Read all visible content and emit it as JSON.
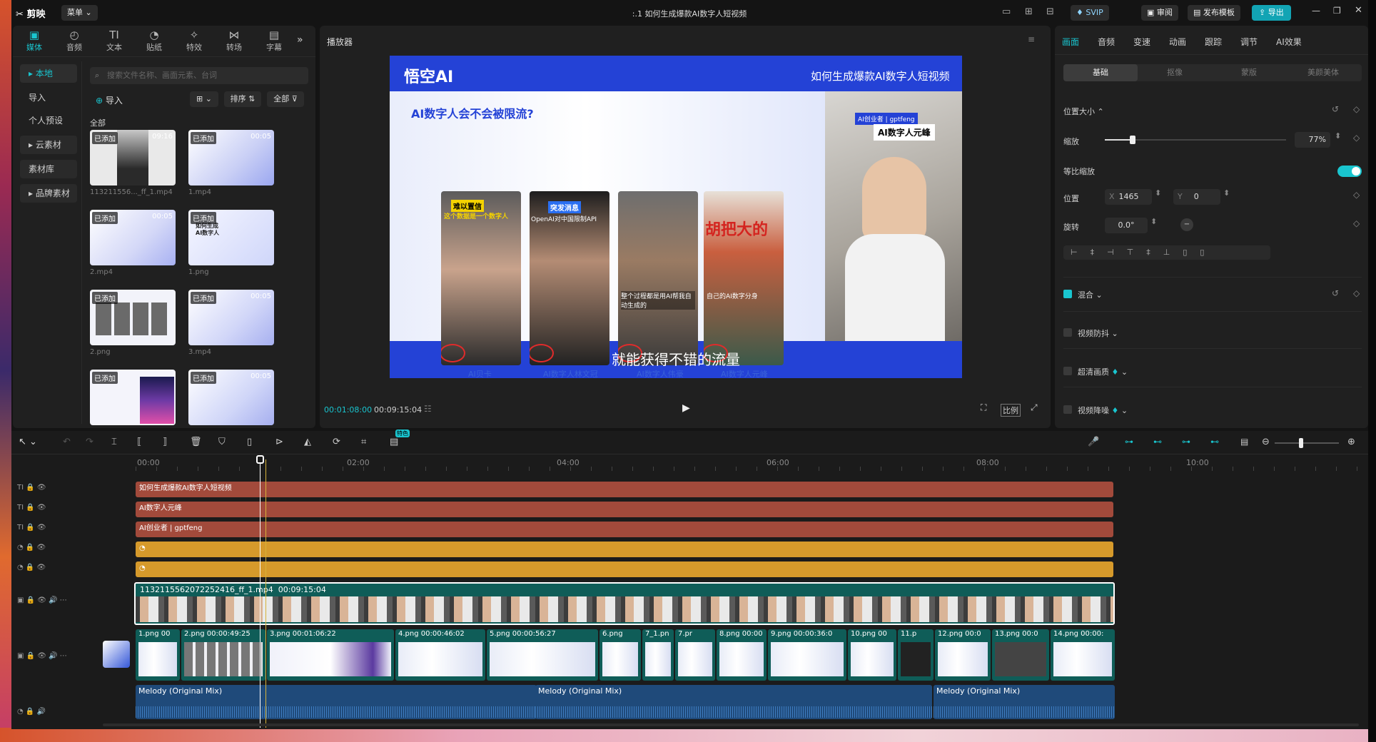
{
  "titlebar": {
    "app_name": "剪映",
    "menu_label": "菜单",
    "project_title": ":.1 如何生成爆款AI数字人短视频",
    "svip": "SVIP",
    "review": "审阅",
    "publish_template": "发布模板",
    "export": "导出"
  },
  "media_tabs": [
    {
      "label": "媒体"
    },
    {
      "label": "音频"
    },
    {
      "label": "文本"
    },
    {
      "label": "贴纸"
    },
    {
      "label": "特效"
    },
    {
      "label": "转场"
    },
    {
      "label": "字幕"
    }
  ],
  "media_sidebar": [
    "本地",
    "导入",
    "个人预设",
    "云素材",
    "素材库",
    "品牌素材"
  ],
  "media_search": {
    "placeholder": "搜索文件名称、画面元素、台词"
  },
  "media_toolbar": {
    "import": "导入",
    "sort": "排序",
    "all": "全部"
  },
  "media_section": "全部",
  "media_items": [
    {
      "tag": "已添加",
      "duration": "09:16",
      "name": "113211556..._ff_1.mp4"
    },
    {
      "tag": "已添加",
      "duration": "00:05",
      "name": "1.mp4"
    },
    {
      "tag": "已添加",
      "duration": "00:05",
      "name": "2.mp4"
    },
    {
      "tag": "已添加",
      "duration": "",
      "name": "1.png"
    },
    {
      "tag": "已添加",
      "duration": "",
      "name": "2.png"
    },
    {
      "tag": "已添加",
      "duration": "00:05",
      "name": "3.mp4"
    },
    {
      "tag": "已添加",
      "duration": "",
      "name": ""
    },
    {
      "tag": "已添加",
      "duration": "00:05",
      "name": ""
    }
  ],
  "player": {
    "title": "播放器",
    "current_time": "00:01:08:00",
    "total_time": "00:09:15:04",
    "ratio": "比例",
    "video": {
      "brand": "悟空AI",
      "header_title": "如何生成爆款AI数字人短视频",
      "question": "AI数字人会不会被限流?",
      "cards": [
        {
          "top": "难以置信",
          "sub": "这个数据是一个数字人",
          "label": "AI贝卡"
        },
        {
          "top": "突发消息",
          "sub": "OpenAI对中国限制API",
          "label": "AI数字人林文冠"
        },
        {
          "top": "",
          "sub": "整个过程都是用AI帮我自动生成的",
          "label": "AI数字人伟豪"
        },
        {
          "top": "胡把大的",
          "sub": "自己的AI数字分身",
          "label": "AI数字人元峰"
        }
      ],
      "overlay_tag": "AI创业者 | gptfeng",
      "overlay_name": "AI数字人元峰",
      "subtitle": "就能获得不错的流量"
    }
  },
  "inspector": {
    "tabs": [
      "画面",
      "音频",
      "变速",
      "动画",
      "跟踪",
      "调节",
      "AI效果"
    ],
    "subtabs": [
      "基础",
      "抠像",
      "蒙版",
      "美颜美体"
    ],
    "position_size": "位置大小",
    "scale_label": "缩放",
    "scale_value": "77%",
    "scale_level": 0.77,
    "uniform_scale": "等比缩放",
    "position_label": "位置",
    "pos_x_label": "X",
    "pos_x": "1465",
    "pos_y_label": "Y",
    "pos_y": "0",
    "rotate_label": "旋转",
    "rotate_value": "0.0°",
    "blend": "混合",
    "stabilize": "视频防抖",
    "hd": "超清画质",
    "denoise": "视频降噪"
  },
  "timeline": {
    "ruler": [
      "00:00",
      "02:00",
      "04:00",
      "06:00",
      "08:00",
      "10:00"
    ],
    "text_tracks": [
      "如何生成爆款AI数字人短视频",
      "AI数字人元峰",
      "AI创业者 | gptfeng"
    ],
    "main_clip": {
      "name": "1132115562072252416_ff_1.mp4",
      "duration": "00:09:15:04"
    },
    "image_clips": [
      {
        "name": "1.png",
        "dur": "00"
      },
      {
        "name": "2.png",
        "dur": "00:00:49:25"
      },
      {
        "name": "3.png",
        "dur": "00:01:06:22"
      },
      {
        "name": "4.png",
        "dur": "00:00:46:02"
      },
      {
        "name": "5.png",
        "dur": "00:00:56:27"
      },
      {
        "name": "6.png",
        "dur": ""
      },
      {
        "name": "7_1.pn",
        "dur": ""
      },
      {
        "name": "7.pr",
        "dur": ""
      },
      {
        "name": "8.png",
        "dur": "00:00"
      },
      {
        "name": "9.png",
        "dur": "00:00:36:0"
      },
      {
        "name": "10.png",
        "dur": "00"
      },
      {
        "name": "11.p",
        "dur": ""
      },
      {
        "name": "12.png",
        "dur": "00:0"
      },
      {
        "name": "13.png",
        "dur": "00:0"
      },
      {
        "name": "14.png",
        "dur": "00:00:"
      }
    ],
    "audio_clips": [
      "Melody (Original Mix)",
      "Melody (Original Mix)",
      "Melody (Original Mix)"
    ],
    "badge": "特色"
  }
}
